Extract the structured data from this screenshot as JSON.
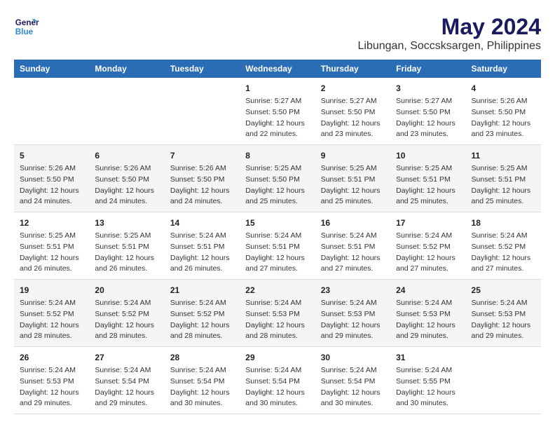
{
  "header": {
    "logo_line1": "General",
    "logo_line2": "Blue",
    "main_title": "May 2024",
    "subtitle": "Libungan, Soccsksargen, Philippines"
  },
  "days_of_week": [
    "Sunday",
    "Monday",
    "Tuesday",
    "Wednesday",
    "Thursday",
    "Friday",
    "Saturday"
  ],
  "weeks": [
    [
      {
        "day": "",
        "info": ""
      },
      {
        "day": "",
        "info": ""
      },
      {
        "day": "",
        "info": ""
      },
      {
        "day": "1",
        "info": "Sunrise: 5:27 AM\nSunset: 5:50 PM\nDaylight: 12 hours\nand 22 minutes."
      },
      {
        "day": "2",
        "info": "Sunrise: 5:27 AM\nSunset: 5:50 PM\nDaylight: 12 hours\nand 23 minutes."
      },
      {
        "day": "3",
        "info": "Sunrise: 5:27 AM\nSunset: 5:50 PM\nDaylight: 12 hours\nand 23 minutes."
      },
      {
        "day": "4",
        "info": "Sunrise: 5:26 AM\nSunset: 5:50 PM\nDaylight: 12 hours\nand 23 minutes."
      }
    ],
    [
      {
        "day": "5",
        "info": "Sunrise: 5:26 AM\nSunset: 5:50 PM\nDaylight: 12 hours\nand 24 minutes."
      },
      {
        "day": "6",
        "info": "Sunrise: 5:26 AM\nSunset: 5:50 PM\nDaylight: 12 hours\nand 24 minutes."
      },
      {
        "day": "7",
        "info": "Sunrise: 5:26 AM\nSunset: 5:50 PM\nDaylight: 12 hours\nand 24 minutes."
      },
      {
        "day": "8",
        "info": "Sunrise: 5:25 AM\nSunset: 5:50 PM\nDaylight: 12 hours\nand 25 minutes."
      },
      {
        "day": "9",
        "info": "Sunrise: 5:25 AM\nSunset: 5:51 PM\nDaylight: 12 hours\nand 25 minutes."
      },
      {
        "day": "10",
        "info": "Sunrise: 5:25 AM\nSunset: 5:51 PM\nDaylight: 12 hours\nand 25 minutes."
      },
      {
        "day": "11",
        "info": "Sunrise: 5:25 AM\nSunset: 5:51 PM\nDaylight: 12 hours\nand 25 minutes."
      }
    ],
    [
      {
        "day": "12",
        "info": "Sunrise: 5:25 AM\nSunset: 5:51 PM\nDaylight: 12 hours\nand 26 minutes."
      },
      {
        "day": "13",
        "info": "Sunrise: 5:25 AM\nSunset: 5:51 PM\nDaylight: 12 hours\nand 26 minutes."
      },
      {
        "day": "14",
        "info": "Sunrise: 5:24 AM\nSunset: 5:51 PM\nDaylight: 12 hours\nand 26 minutes."
      },
      {
        "day": "15",
        "info": "Sunrise: 5:24 AM\nSunset: 5:51 PM\nDaylight: 12 hours\nand 27 minutes."
      },
      {
        "day": "16",
        "info": "Sunrise: 5:24 AM\nSunset: 5:51 PM\nDaylight: 12 hours\nand 27 minutes."
      },
      {
        "day": "17",
        "info": "Sunrise: 5:24 AM\nSunset: 5:52 PM\nDaylight: 12 hours\nand 27 minutes."
      },
      {
        "day": "18",
        "info": "Sunrise: 5:24 AM\nSunset: 5:52 PM\nDaylight: 12 hours\nand 27 minutes."
      }
    ],
    [
      {
        "day": "19",
        "info": "Sunrise: 5:24 AM\nSunset: 5:52 PM\nDaylight: 12 hours\nand 28 minutes."
      },
      {
        "day": "20",
        "info": "Sunrise: 5:24 AM\nSunset: 5:52 PM\nDaylight: 12 hours\nand 28 minutes."
      },
      {
        "day": "21",
        "info": "Sunrise: 5:24 AM\nSunset: 5:52 PM\nDaylight: 12 hours\nand 28 minutes."
      },
      {
        "day": "22",
        "info": "Sunrise: 5:24 AM\nSunset: 5:53 PM\nDaylight: 12 hours\nand 28 minutes."
      },
      {
        "day": "23",
        "info": "Sunrise: 5:24 AM\nSunset: 5:53 PM\nDaylight: 12 hours\nand 29 minutes."
      },
      {
        "day": "24",
        "info": "Sunrise: 5:24 AM\nSunset: 5:53 PM\nDaylight: 12 hours\nand 29 minutes."
      },
      {
        "day": "25",
        "info": "Sunrise: 5:24 AM\nSunset: 5:53 PM\nDaylight: 12 hours\nand 29 minutes."
      }
    ],
    [
      {
        "day": "26",
        "info": "Sunrise: 5:24 AM\nSunset: 5:53 PM\nDaylight: 12 hours\nand 29 minutes."
      },
      {
        "day": "27",
        "info": "Sunrise: 5:24 AM\nSunset: 5:54 PM\nDaylight: 12 hours\nand 29 minutes."
      },
      {
        "day": "28",
        "info": "Sunrise: 5:24 AM\nSunset: 5:54 PM\nDaylight: 12 hours\nand 30 minutes."
      },
      {
        "day": "29",
        "info": "Sunrise: 5:24 AM\nSunset: 5:54 PM\nDaylight: 12 hours\nand 30 minutes."
      },
      {
        "day": "30",
        "info": "Sunrise: 5:24 AM\nSunset: 5:54 PM\nDaylight: 12 hours\nand 30 minutes."
      },
      {
        "day": "31",
        "info": "Sunrise: 5:24 AM\nSunset: 5:55 PM\nDaylight: 12 hours\nand 30 minutes."
      },
      {
        "day": "",
        "info": ""
      }
    ]
  ]
}
